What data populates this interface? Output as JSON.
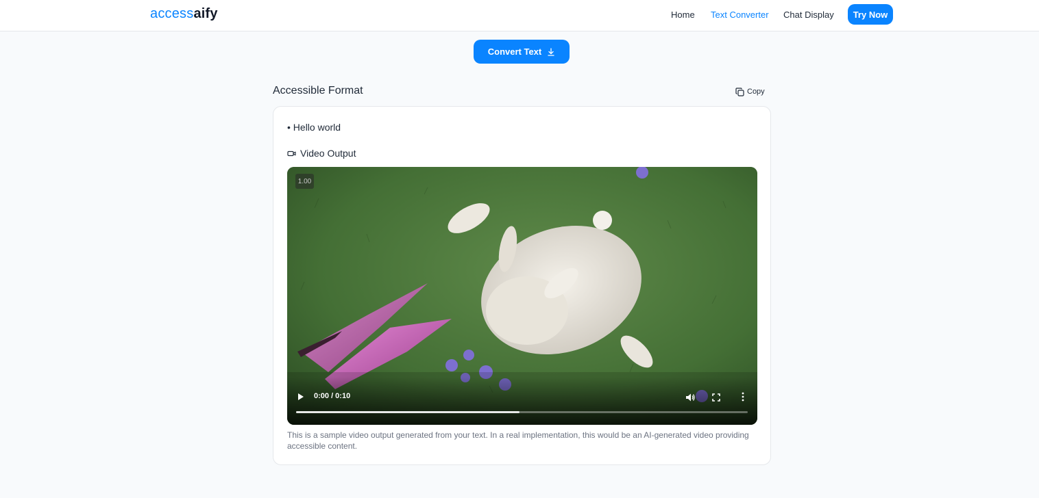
{
  "header": {
    "logo_part1": "access",
    "logo_part2": "aify",
    "nav": [
      "Home",
      "Text Converter",
      "Chat Display"
    ],
    "active_nav": "Text Converter",
    "cta_label": "Try Now"
  },
  "convert": {
    "label": "Convert Text",
    "icon": "download-icon"
  },
  "output": {
    "title": "Accessible Format",
    "copy_label": "Copy",
    "bullet": "• Hello world",
    "video_label": "Video Output",
    "caption": "This is a sample video output generated from your text. In a real implementation, this would be an AI-generated video providing accessible content."
  },
  "video": {
    "playback_rate": "1.00",
    "time": "0:00 / 0:10",
    "buffered_fraction": 0.495,
    "icons": [
      "play-icon",
      "volume-icon",
      "fullscreen-icon",
      "more-vert-icon"
    ]
  },
  "colors": {
    "accent": "#0a84ff",
    "background": "#f8fafc",
    "muted_text": "#6b7280"
  }
}
